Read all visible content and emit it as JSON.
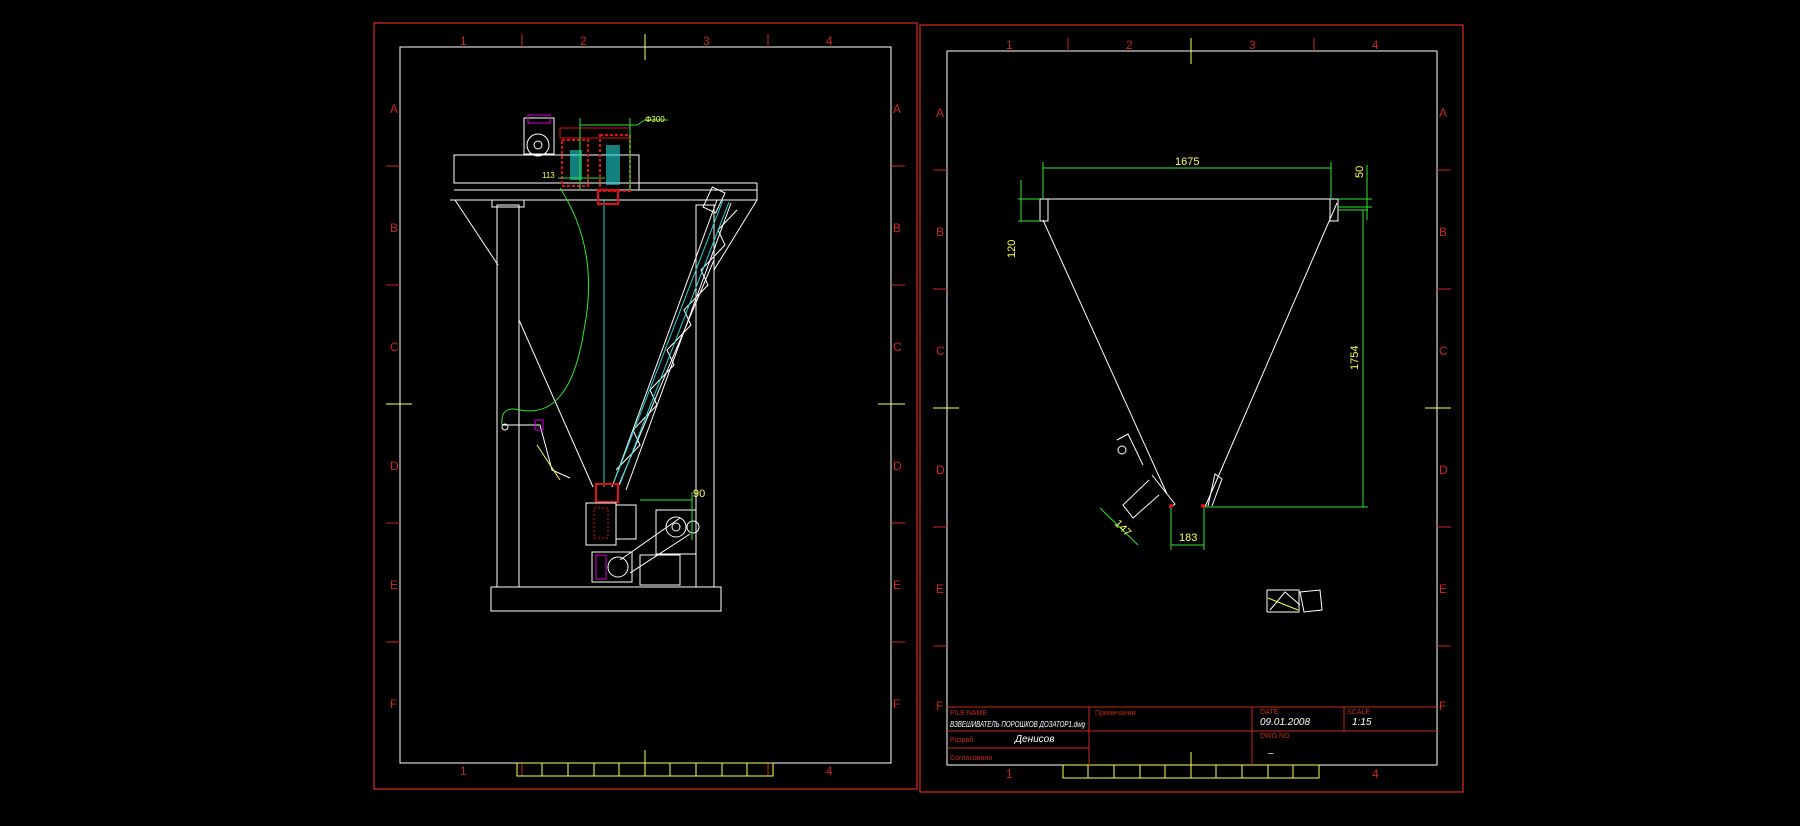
{
  "colors": {
    "background": "#000000",
    "frame": "#c8281e",
    "geometry": "#ffffff",
    "dimension": "#2ee62e",
    "dim_text": "#ffff4d",
    "cyan": "#22d3d3",
    "magenta": "#d400d4",
    "red_part": "#e01010"
  },
  "grid": {
    "columns": [
      "1",
      "2",
      "3",
      "4"
    ],
    "rows": [
      "A",
      "B",
      "C",
      "D",
      "E",
      "F"
    ]
  },
  "sheet_left": {
    "dimensions": {
      "diameter": "Φ300",
      "d1": "113",
      "d2": "90"
    }
  },
  "sheet_right": {
    "dimensions": {
      "top_width": "1675",
      "top_thickness": "50",
      "left_height": "120",
      "height": "1754",
      "outlet_width": "183",
      "outlet_flange": "147"
    },
    "title_block": {
      "file_name_label": "FILE NAME",
      "file_name_value": "ВЗВЕШИВАТЕЛЬ ПОРОШКОВ ДОЗАТОР1.dwg",
      "date_label": "DATE",
      "date_value": "09.01.2008",
      "scale_label": "SCALE",
      "scale_value": "1:15",
      "drawn_label": "Разраб",
      "drawn_value": "Денисов",
      "approved_label": "Согласовано",
      "notes_label": "Примечания",
      "dwg_no_label": "DWG NO",
      "dwg_no_value": "–"
    }
  }
}
